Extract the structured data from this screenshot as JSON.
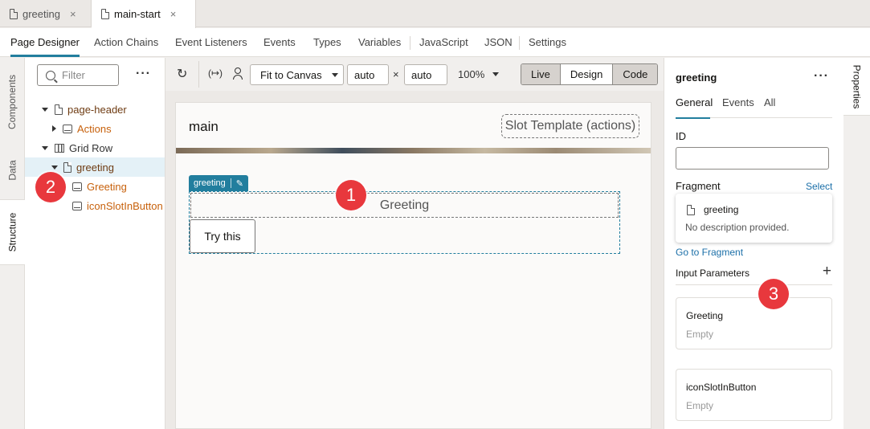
{
  "tabs": [
    {
      "label": "greeting",
      "close": "×"
    },
    {
      "label": "main-start",
      "close": "×"
    }
  ],
  "subnav": [
    "Page Designer",
    "Action Chains",
    "Event Listeners",
    "Events",
    "Types",
    "Variables",
    "JavaScript",
    "JSON",
    "Settings"
  ],
  "left_tabs": [
    "Components",
    "Data",
    "Structure"
  ],
  "structure": {
    "filter_placeholder": "Filter",
    "more": "···",
    "tree": [
      "page-header",
      "Actions",
      "Grid Row",
      "greeting",
      "Greeting",
      "iconSlotInButton"
    ]
  },
  "toolbar": {
    "refresh_icon": "↻",
    "variables_icon": "(↦)",
    "fit": "Fit to Canvas",
    "width": "auto",
    "times": "×",
    "height": "auto",
    "zoom": "100%",
    "modes": [
      "Live",
      "Design",
      "Code"
    ]
  },
  "canvas": {
    "title": "main",
    "slot_label": "Slot Template (actions)",
    "fragment_tag": "greeting",
    "greeting_text": "Greeting",
    "button_label": "Try this"
  },
  "badges": [
    "1",
    "2",
    "3"
  ],
  "properties": {
    "title": "greeting",
    "more": "···",
    "tabs": [
      "General",
      "Events",
      "All"
    ],
    "id_label": "ID",
    "fragment_label": "Fragment",
    "select_link": "Select",
    "fragment_name": "greeting",
    "fragment_desc": "No description provided.",
    "goto_link": "Go to Fragment",
    "input_params_label": "Input Parameters",
    "add_icon": "+",
    "params": [
      {
        "name": "Greeting",
        "value": "Empty"
      },
      {
        "name": "iconSlotInButton",
        "value": "Empty"
      }
    ],
    "side_tab": "Properties"
  },
  "colors": {
    "accent": "#227e9e",
    "badge": "#e8383d",
    "orange": "#c7610c"
  }
}
